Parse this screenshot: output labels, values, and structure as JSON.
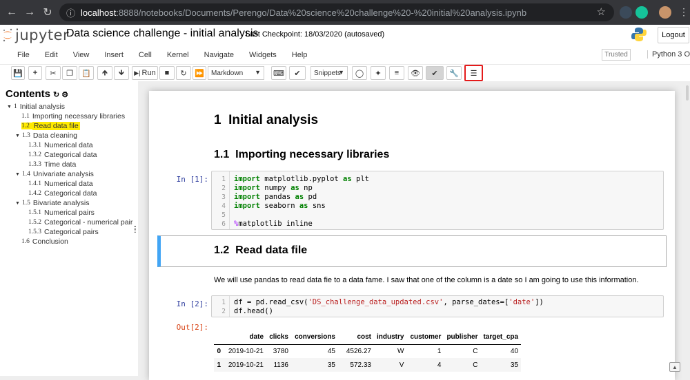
{
  "browser": {
    "url_host": "localhost",
    "url_path": ":8888/notebooks/Documents/Perengo/Data%20science%20challenge%20-%20initial%20analysis.ipynb"
  },
  "header": {
    "logo_text": "jupyter",
    "notebook_title": "Data science challenge - initial analysis",
    "checkpoint": "Last Checkpoint: 18/03/2020  (autosaved)",
    "logout": "Logout"
  },
  "menu": {
    "items": [
      "File",
      "Edit",
      "View",
      "Insert",
      "Cell",
      "Kernel",
      "Navigate",
      "Widgets",
      "Help"
    ],
    "trusted": "Trusted",
    "kernel": "Python 3  O"
  },
  "toolbar": {
    "run": "Run",
    "cell_type": "Markdown",
    "snippets": "Snippets"
  },
  "toc": {
    "title": "Contents",
    "items": [
      {
        "num": "1",
        "label": "Initial analysis"
      },
      {
        "num": "1.1",
        "label": "Importing necessary libraries"
      },
      {
        "num": "1.2",
        "label": "Read data file"
      },
      {
        "num": "1.3",
        "label": "Data cleaning"
      },
      {
        "num": "1.3.1",
        "label": "Numerical data"
      },
      {
        "num": "1.3.2",
        "label": "Categorical data"
      },
      {
        "num": "1.3.3",
        "label": "Time data"
      },
      {
        "num": "1.4",
        "label": "Univariate analysis"
      },
      {
        "num": "1.4.1",
        "label": "Numerical data"
      },
      {
        "num": "1.4.2",
        "label": "Categorical data"
      },
      {
        "num": "1.5",
        "label": "Bivariate analysis"
      },
      {
        "num": "1.5.1",
        "label": "Numerical pairs"
      },
      {
        "num": "1.5.2",
        "label": "Categorical - numerical pairs"
      },
      {
        "num": "1.5.3",
        "label": "Categorical pairs"
      },
      {
        "num": "1.6",
        "label": "Conclusion"
      }
    ]
  },
  "notebook": {
    "h1_num": "1",
    "h1_text": "Initial analysis",
    "h2a_num": "1.1",
    "h2a_text": "Importing necessary libraries",
    "in1": "In [1]:",
    "h2b_num": "1.2",
    "h2b_text": "Read data file",
    "para": "We will use pandas to read data fie to a data fame. I saw that one of the column is a date so I am going to use this information.",
    "in2": "In [2]:",
    "out2": "Out[2]:",
    "table": {
      "columns": [
        "",
        "date",
        "clicks",
        "conversions",
        "cost",
        "industry",
        "customer",
        "publisher",
        "target_cpa"
      ],
      "rows": [
        [
          "0",
          "2019-10-21",
          "3780",
          "45",
          "4526.27",
          "W",
          "1",
          "C",
          "40"
        ],
        [
          "1",
          "2019-10-21",
          "1136",
          "35",
          "572.33",
          "V",
          "4",
          "C",
          "35"
        ]
      ]
    }
  }
}
